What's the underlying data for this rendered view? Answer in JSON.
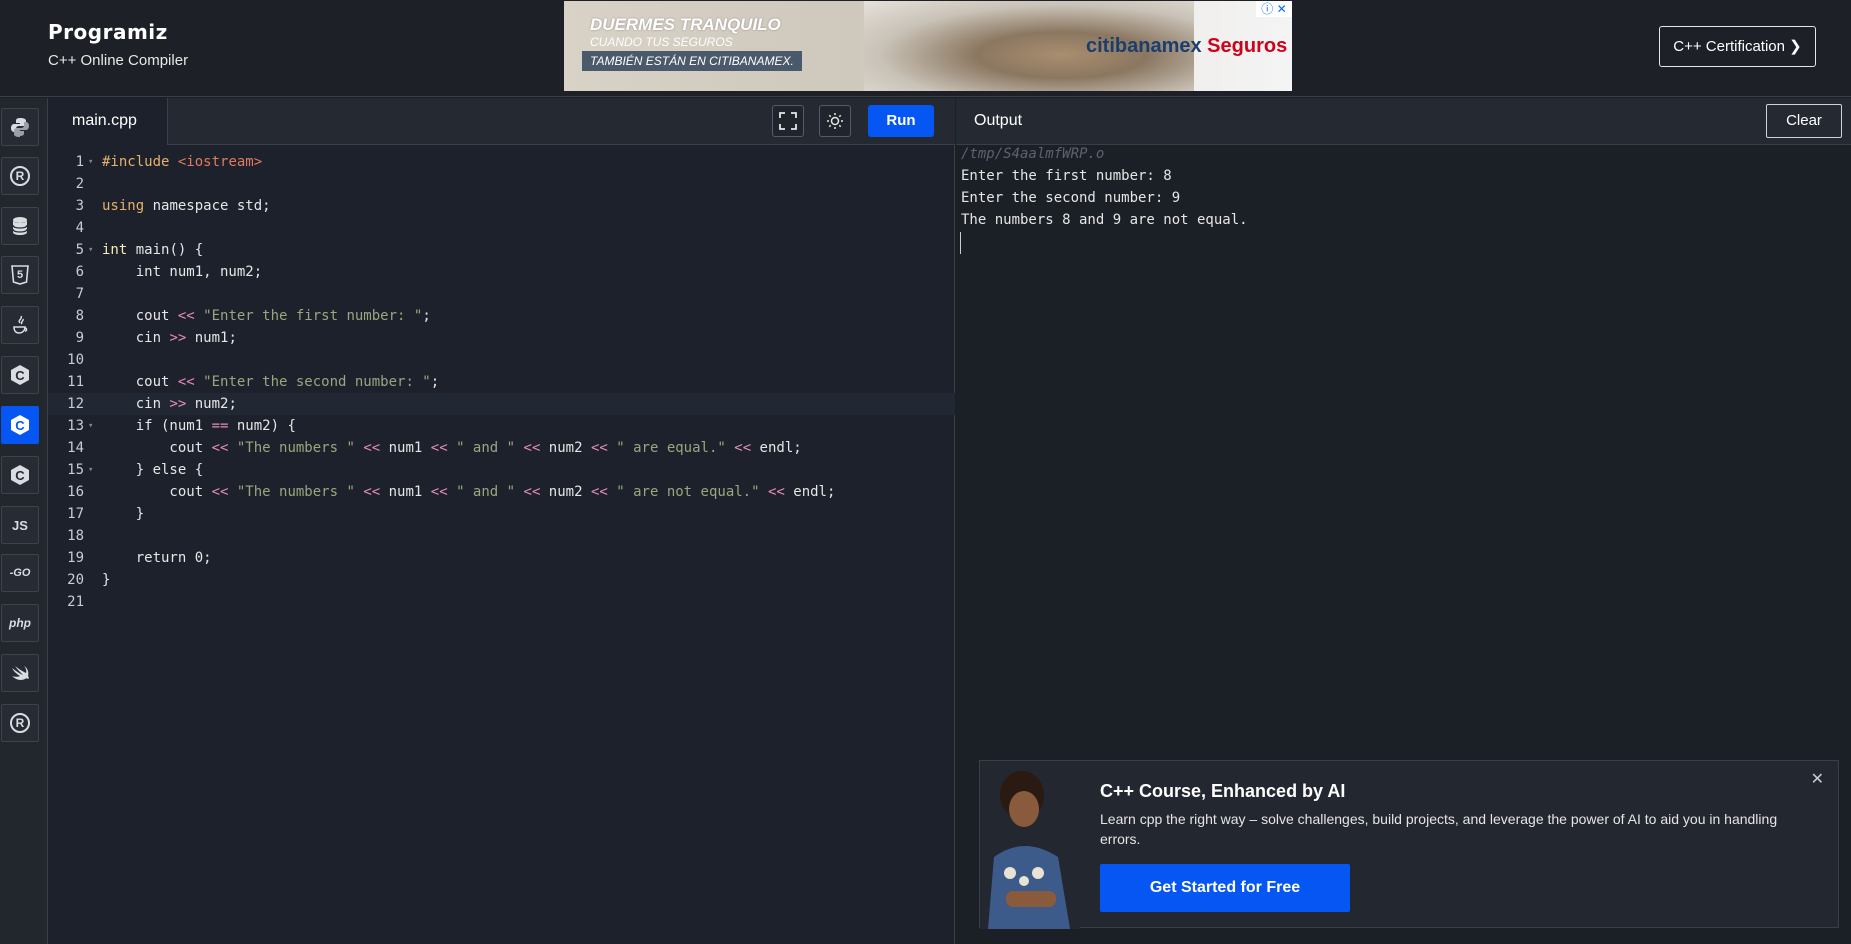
{
  "header": {
    "logo": "Programiz",
    "subtitle": "C++ Online Compiler",
    "ad": {
      "headline": "DUERMES TRANQUILO",
      "sub1": "CUANDO TUS SEGUROS",
      "sub2": "TAMBIÉN ESTÁN EN CITIBANAMEX.",
      "brand_main": "citibanamex",
      "brand_tail": " Seguros",
      "close": "ⓘ ✕"
    },
    "cert_button": "C++ Certification ❯"
  },
  "languages": [
    {
      "name": "python",
      "label": ""
    },
    {
      "name": "r",
      "label": "R"
    },
    {
      "name": "sql",
      "label": ""
    },
    {
      "name": "html",
      "label": "5"
    },
    {
      "name": "java",
      "label": ""
    },
    {
      "name": "c",
      "label": "C"
    },
    {
      "name": "cpp",
      "label": "C",
      "active": true
    },
    {
      "name": "csharp",
      "label": "C"
    },
    {
      "name": "js",
      "label": "JS"
    },
    {
      "name": "go",
      "label": "-GO"
    },
    {
      "name": "php",
      "label": "php"
    },
    {
      "name": "swift",
      "label": ""
    },
    {
      "name": "rust",
      "label": "R"
    }
  ],
  "editor": {
    "tab": "main.cpp",
    "run_label": "Run",
    "current_line": 12,
    "lines": [
      "#include <iostream>",
      "",
      "using namespace std;",
      "",
      "int main() {",
      "    int num1, num2;",
      "",
      "    cout << \"Enter the first number: \";",
      "    cin >> num1;",
      "",
      "    cout << \"Enter the second number: \";",
      "    cin >> num2;",
      "    if (num1 == num2) {",
      "        cout << \"The numbers \" << num1 << \" and \" << num2 << \" are equal.\" << endl;",
      "    } else {",
      "        cout << \"The numbers \" << num1 << \" and \" << num2 << \" are not equal.\" << endl;",
      "    }",
      "",
      "    return 0;",
      "}",
      ""
    ],
    "line_numbers": [
      "1",
      "2",
      "3",
      "4",
      "5",
      "6",
      "7",
      "8",
      "9",
      "10",
      "11",
      "12",
      "13",
      "14",
      "15",
      "16",
      "17",
      "18",
      "19",
      "20",
      "21"
    ],
    "foldable": [
      1,
      5,
      13,
      15
    ]
  },
  "output": {
    "title": "Output",
    "clear_label": "Clear",
    "path": "/tmp/S4aalmfWRP.o",
    "lines": [
      "Enter the first number: 8",
      "Enter the second number: 9",
      "The numbers 8 and 9 are not equal."
    ]
  },
  "promo": {
    "title": "C++ Course, Enhanced by AI",
    "description": "Learn cpp the right way – solve challenges, build projects, and leverage the power of AI to aid you in handling errors.",
    "button": "Get Started for Free",
    "close": "✕"
  },
  "colors": {
    "accent": "#0556f3",
    "bg": "#1c212b"
  }
}
